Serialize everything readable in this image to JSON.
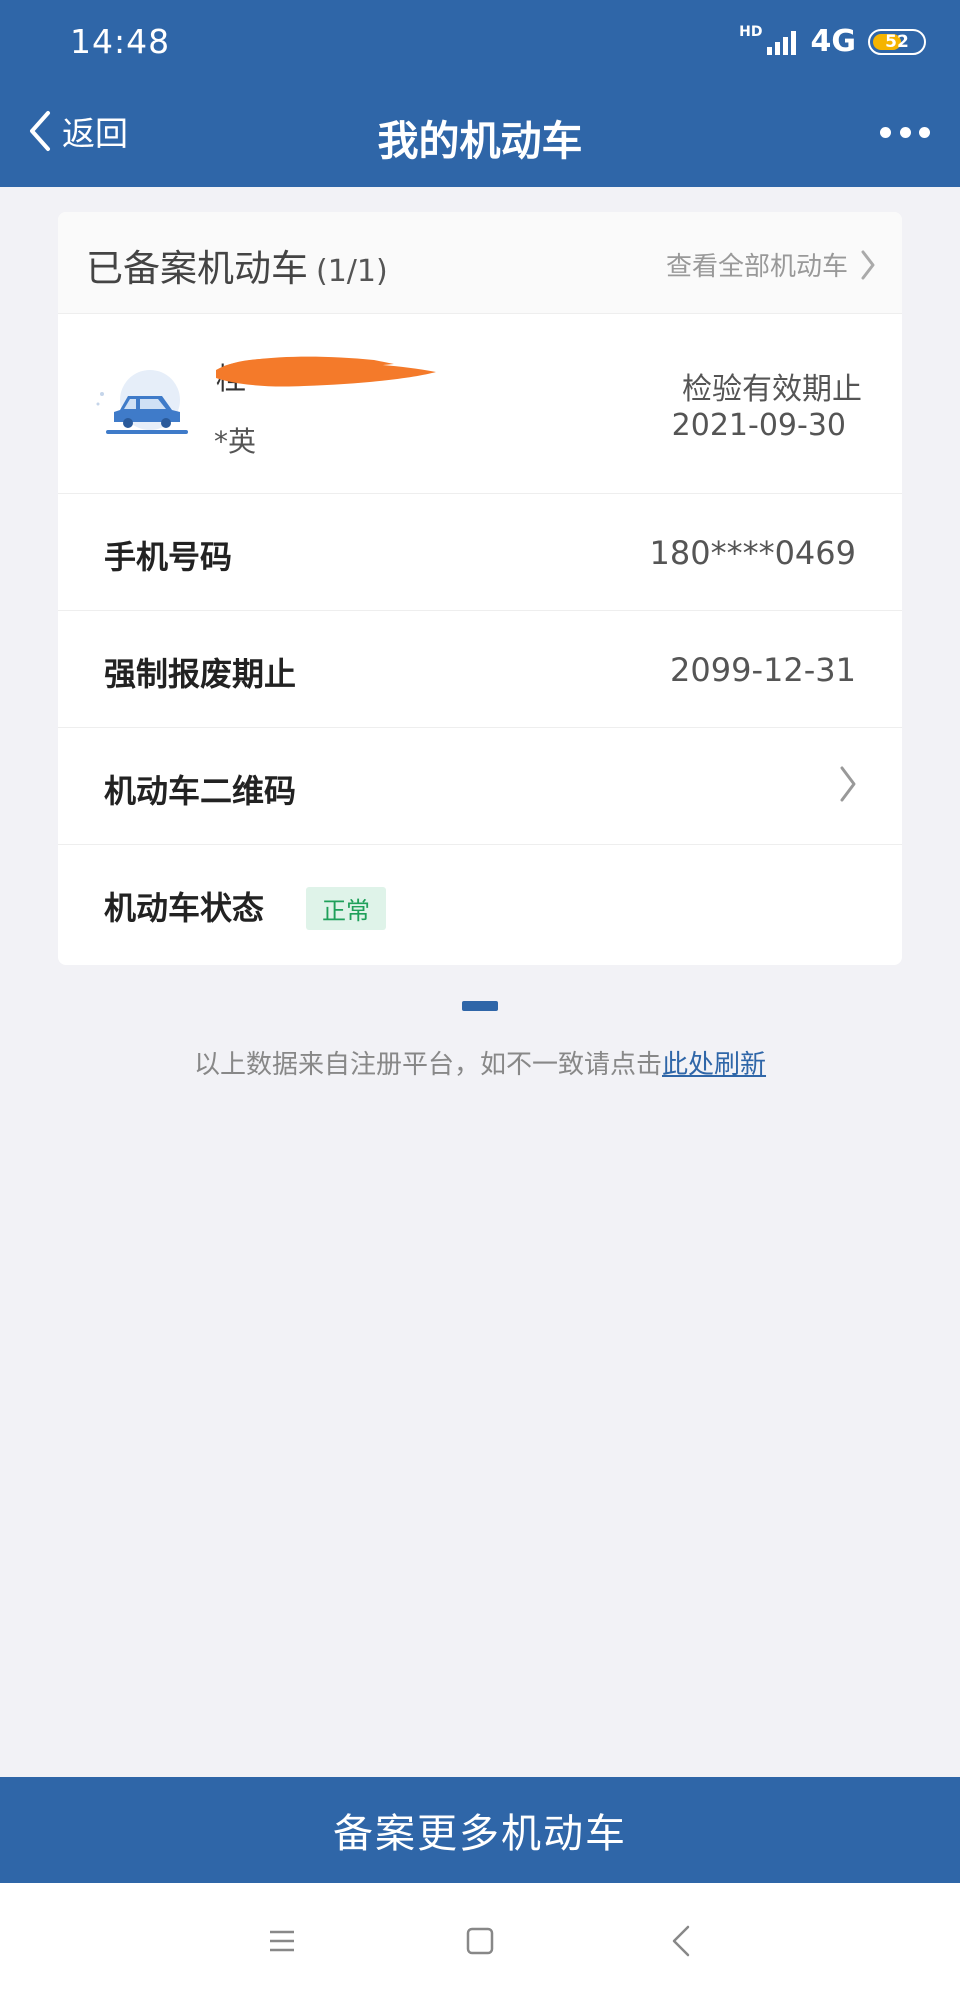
{
  "status_bar": {
    "time": "14:48",
    "network": "4G",
    "signal_label": "HD",
    "battery": "52"
  },
  "nav": {
    "back_label": "返回",
    "title": "我的机动车",
    "more_icon": "more-dots-icon"
  },
  "card": {
    "title": "已备案机动车",
    "count": "(1/1)",
    "view_all_label": "查看全部机动车",
    "vehicle": {
      "plate_visible_char": "桂",
      "owner": "*英",
      "inspection_label": "检验有效期止",
      "inspection_date": "2021-09-30"
    },
    "rows": [
      {
        "label": "手机号码",
        "value": "180****0469"
      },
      {
        "label": "强制报废期止",
        "value": "2099-12-31"
      },
      {
        "label": "机动车二维码"
      },
      {
        "label": "机动车状态",
        "badge": "正常"
      }
    ]
  },
  "notice": {
    "text": "以上数据来自注册平台，如不一致请点击",
    "link": "此处刷新"
  },
  "bottom_button": {
    "label": "备案更多机动车"
  },
  "colors": {
    "primary": "#2f66a8",
    "badge_bg": "#dff3e9",
    "badge_text": "#1fa05a",
    "redaction": "#f47a2a"
  }
}
